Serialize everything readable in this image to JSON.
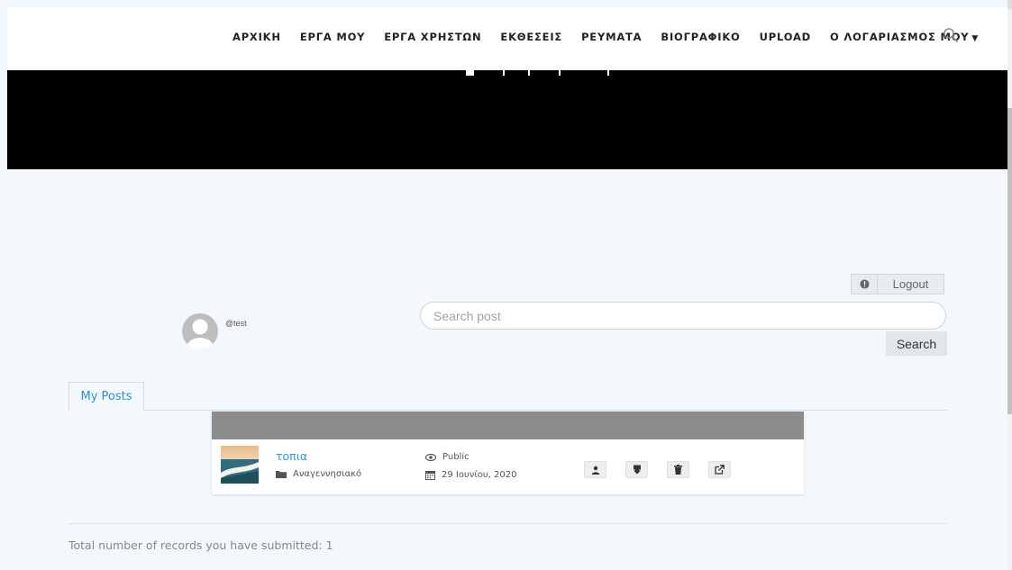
{
  "nav": {
    "items": [
      {
        "label": "ΑΡΧΙΚΗ"
      },
      {
        "label": "ΕΡΓΑ ΜΟΥ"
      },
      {
        "label": "ΕΡΓΑ ΧΡΗΣΤΩΝ"
      },
      {
        "label": "ΕΚΘΕΣΕΙΣ"
      },
      {
        "label": "ΡΕΥΜΑΤΑ"
      },
      {
        "label": "ΒΙΟΓΡΑΦΙΚΟ"
      },
      {
        "label": "UPLOAD"
      },
      {
        "label": "Ο ΛΟΓΑΡΙΑΣΜΟΣ ΜΟΥ"
      }
    ],
    "search_icon": "search-icon",
    "account_caret_icon": "caret-down-icon"
  },
  "profile": {
    "username": "@test",
    "avatar_icon": "default-user-avatar"
  },
  "logout": {
    "label": "Logout",
    "icon": "info-circle-icon"
  },
  "search": {
    "placeholder": "Search post",
    "value": "",
    "button_label": "Search"
  },
  "tabs": [
    {
      "label": "My Posts"
    }
  ],
  "posts": [
    {
      "title": "τοπια",
      "category": "Αναγεννησιακό",
      "visibility": "Public",
      "date": "29 Ιουνίου, 2020",
      "actions": [
        "user-icon",
        "download-icon",
        "trash-icon",
        "external-link-icon"
      ]
    }
  ],
  "footer": {
    "text": "Total number of records you have submitted: 1"
  },
  "colors": {
    "page_bg": "#f2f8fb",
    "hero_bg": "#000000",
    "accent": "#2a8fc9",
    "card_header": "#8c8c8c"
  }
}
